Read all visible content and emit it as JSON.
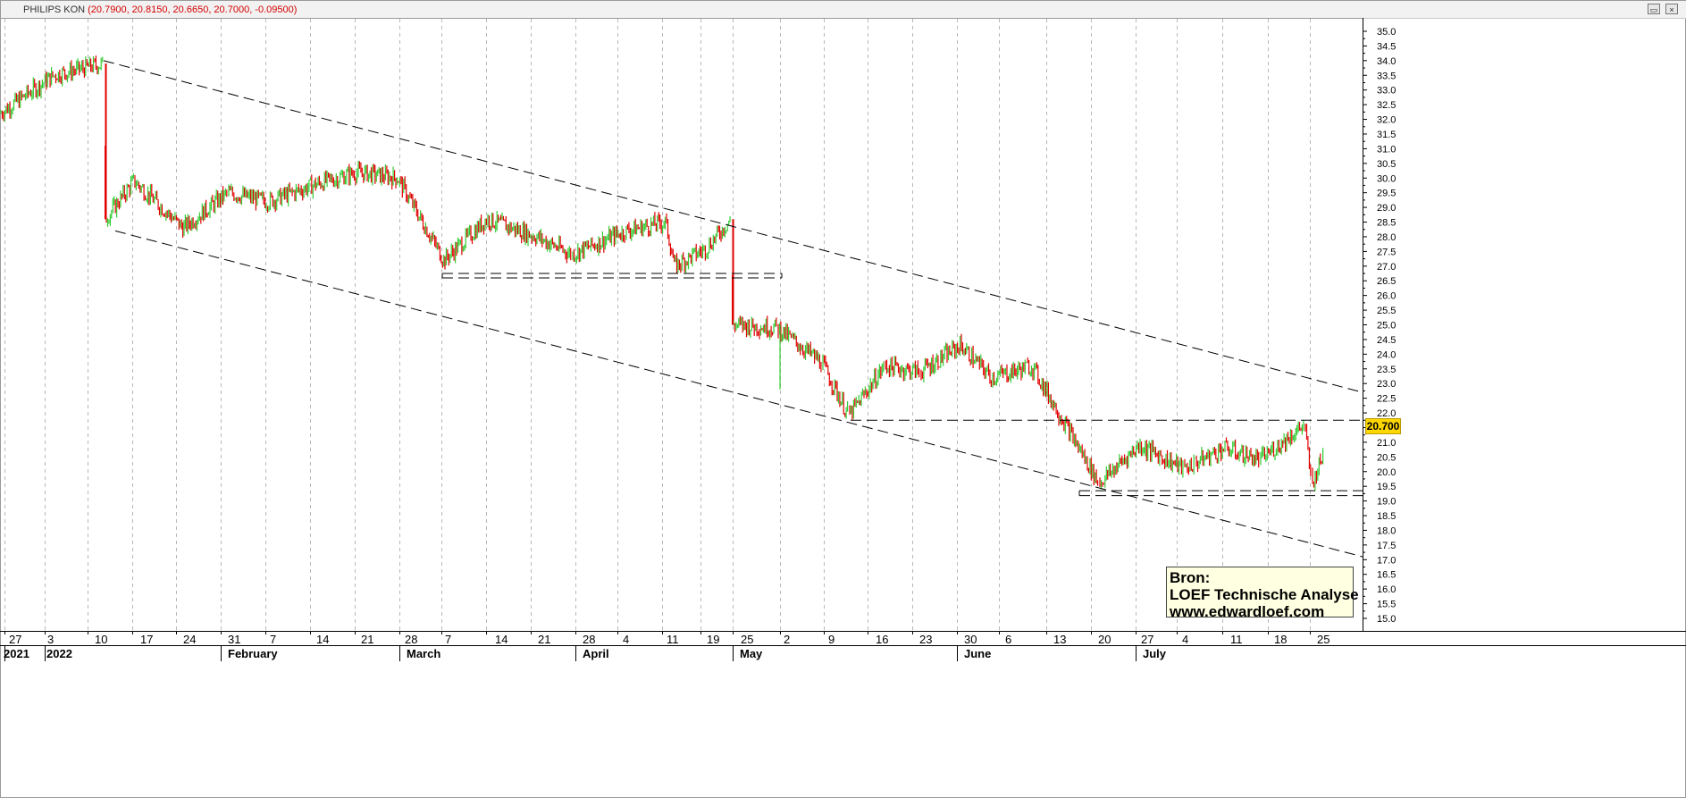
{
  "window": {
    "symbol": "PHILIPS KON",
    "ohlc_text": "(20.7900, 20.8150, 20.6650, 20.7000, -0.09500)",
    "buttons": [
      "restore-icon",
      "close-icon"
    ]
  },
  "colors": {
    "up": "#33cc33",
    "down": "#e00000",
    "trendline": "#000000",
    "grid": "#b8b8b8",
    "badge": "#ffd700",
    "source_box": "#ffffe1"
  },
  "source_box": {
    "line1": "Bron:",
    "line2": "LOEF Technische Analyse",
    "line3": "www.edwardloef.com"
  },
  "last_price_label": "20.700",
  "chart_data": {
    "type": "candlestick",
    "title": "",
    "x_axis": {
      "day_labels": [
        "27",
        "3",
        "10",
        "17",
        "24",
        "31",
        "7",
        "14",
        "21",
        "28",
        "7",
        "14",
        "21",
        "28",
        "4",
        "11",
        "19",
        "25",
        "2",
        "9",
        "16",
        "23",
        "30",
        "6",
        "13",
        "20",
        "27",
        "4",
        "11",
        "18",
        "25"
      ],
      "month_labels": [
        {
          "label": "2021",
          "at": "27"
        },
        {
          "label": "2022",
          "at": "3"
        },
        {
          "label": "February",
          "at": "31"
        },
        {
          "label": "March",
          "at": "28"
        },
        {
          "label": "April",
          "at": "28"
        },
        {
          "label": "May",
          "at": "25"
        },
        {
          "label": "June",
          "at": "30"
        },
        {
          "label": "July",
          "at": "27"
        }
      ]
    },
    "y_axis": {
      "ylim": [
        15.0,
        35.0
      ],
      "ticks": [
        "15.0",
        "15.5",
        "16.0",
        "16.5",
        "17.0",
        "17.5",
        "18.0",
        "18.5",
        "19.0",
        "19.5",
        "20.0",
        "20.5",
        "21.0",
        "21.5",
        "22.0",
        "22.5",
        "23.0",
        "23.5",
        "24.0",
        "24.5",
        "25.0",
        "25.5",
        "26.0",
        "26.5",
        "27.0",
        "27.5",
        "28.0",
        "28.5",
        "29.0",
        "29.5",
        "30.0",
        "30.5",
        "31.0",
        "31.5",
        "32.0",
        "32.5",
        "33.0",
        "33.5",
        "34.0",
        "34.5",
        "35.0"
      ]
    },
    "last_price": 20.7,
    "price_path_weekly": [
      {
        "week": "27",
        "price": 32.2
      },
      {
        "week": "3",
        "price": 33.5
      },
      {
        "week": "10",
        "price": 33.9
      },
      {
        "week": "10",
        "price": 28.6
      },
      {
        "week": "17",
        "price": 29.9
      },
      {
        "week": "24",
        "price": 28.3
      },
      {
        "week": "31",
        "price": 29.5
      },
      {
        "week": "7",
        "price": 29.2
      },
      {
        "week": "14",
        "price": 29.8
      },
      {
        "week": "21",
        "price": 30.2
      },
      {
        "week": "28",
        "price": 30.0
      },
      {
        "week": "7",
        "price": 27.2
      },
      {
        "week": "14",
        "price": 28.6
      },
      {
        "week": "21",
        "price": 28.0
      },
      {
        "week": "28",
        "price": 27.4
      },
      {
        "week": "4",
        "price": 28.2
      },
      {
        "week": "11",
        "price": 28.5
      },
      {
        "week": "11",
        "price": 27.0
      },
      {
        "week": "19",
        "price": 27.6
      },
      {
        "week": "25",
        "price": 28.6
      },
      {
        "week": "25",
        "price": 25.0
      },
      {
        "week": "2",
        "price": 24.9
      },
      {
        "week": "9",
        "price": 23.7
      },
      {
        "week": "9",
        "price": 21.9
      },
      {
        "week": "16",
        "price": 23.6
      },
      {
        "week": "23",
        "price": 23.4
      },
      {
        "week": "30",
        "price": 24.3
      },
      {
        "week": "6",
        "price": 23.2
      },
      {
        "week": "13",
        "price": 23.6
      },
      {
        "week": "13",
        "price": 21.2
      },
      {
        "week": "20",
        "price": 19.6
      },
      {
        "week": "27",
        "price": 20.9
      },
      {
        "week": "4",
        "price": 20.1
      },
      {
        "week": "11",
        "price": 20.8
      },
      {
        "week": "18",
        "price": 20.4
      },
      {
        "week": "25",
        "price": 21.6
      },
      {
        "week": "25",
        "price": 19.5
      },
      {
        "week": "25",
        "price": 20.7
      }
    ],
    "trendlines": [
      {
        "name": "upper-channel",
        "from": {
          "x": "10",
          "y": 34.0
        },
        "to": {
          "x": "beyond 25",
          "y": 22.7
        },
        "style": "dashed"
      },
      {
        "name": "lower-channel",
        "from": {
          "x": "10",
          "y": 28.2
        },
        "to": {
          "x": "beyond 25",
          "y": 17.1
        },
        "style": "dashed"
      },
      {
        "name": "support-march",
        "from": {
          "x": "7",
          "y": 26.65
        },
        "to": {
          "x": "2",
          "y": 26.65
        },
        "style": "dashed"
      },
      {
        "name": "resistance-may-july",
        "from": {
          "x": "9",
          "y": 21.75
        },
        "to": {
          "x": "beyond 25",
          "y": 21.75
        },
        "style": "dashed"
      },
      {
        "name": "support-june-july-top",
        "from": {
          "x": "20",
          "y": 19.35
        },
        "to": {
          "x": "beyond 25",
          "y": 19.35
        },
        "style": "dashed"
      },
      {
        "name": "support-june-july-bottom",
        "from": {
          "x": "20",
          "y": 19.18
        },
        "to": {
          "x": "beyond 25",
          "y": 19.18
        },
        "style": "dashed"
      }
    ],
    "grid": true,
    "legend": "none"
  }
}
